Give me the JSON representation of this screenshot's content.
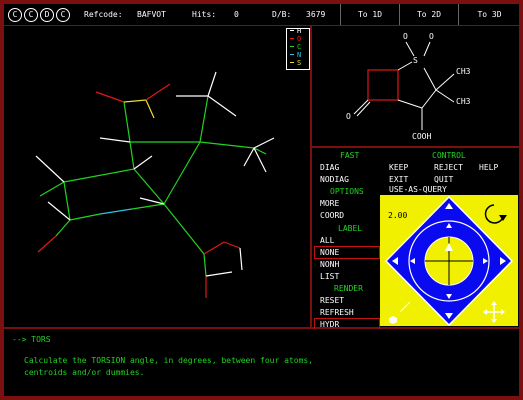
{
  "topbar": {
    "logo_letters": [
      "C",
      "C",
      "D",
      "C"
    ],
    "refcode_label": "Refcode:",
    "refcode_value": "BAFVOT",
    "hits_label": "Hits:",
    "hits_value": "0",
    "db_label": "D/B:",
    "db_value": "3679",
    "tabs": [
      "To 1D",
      "To 2D",
      "To 3D"
    ]
  },
  "legend": {
    "items": [
      {
        "label": "H",
        "color": "#ffffff"
      },
      {
        "label": "O",
        "color": "#e01818"
      },
      {
        "label": "C",
        "color": "#21d321"
      },
      {
        "label": "N",
        "color": "#2cc6e0"
      },
      {
        "label": "S",
        "color": "#e8e030"
      }
    ]
  },
  "structure2d": {
    "atoms": [
      "O",
      "O",
      "S",
      "CH3",
      "CH3",
      "O",
      "COOH"
    ]
  },
  "menu": {
    "fast_header": "FAST",
    "fast_items": [
      "DIAG",
      "NODIAG"
    ],
    "options_header": "OPTIONS",
    "options_items": [
      "MORE",
      "COORD"
    ],
    "label_header": "LABEL",
    "label_items": [
      "ALL",
      "NONE",
      "NONH",
      "LIST"
    ],
    "render_header": "RENDER",
    "render_items": [
      "RESET",
      "REFRESH",
      "HYDR"
    ],
    "control_header": "CONTROL",
    "control_row1": [
      "KEEP",
      "REJECT",
      "HELP"
    ],
    "control_row2": [
      "EXIT",
      "QUIT"
    ],
    "control_row3": "USE-AS-QUERY",
    "zoom_value": "2.00"
  },
  "status": {
    "prompt": "--> TORS",
    "message_line1": "Calculate the TORSION angle, in degrees, between four atoms,",
    "message_line2": "centroids and/or dummies."
  },
  "colors": {
    "background": "#7a1010",
    "panel": "#000000",
    "menu_green": "#21d321",
    "control_yellow": "#f0f000",
    "control_blue": "#0a0af0",
    "selection_red": "#c01010"
  }
}
